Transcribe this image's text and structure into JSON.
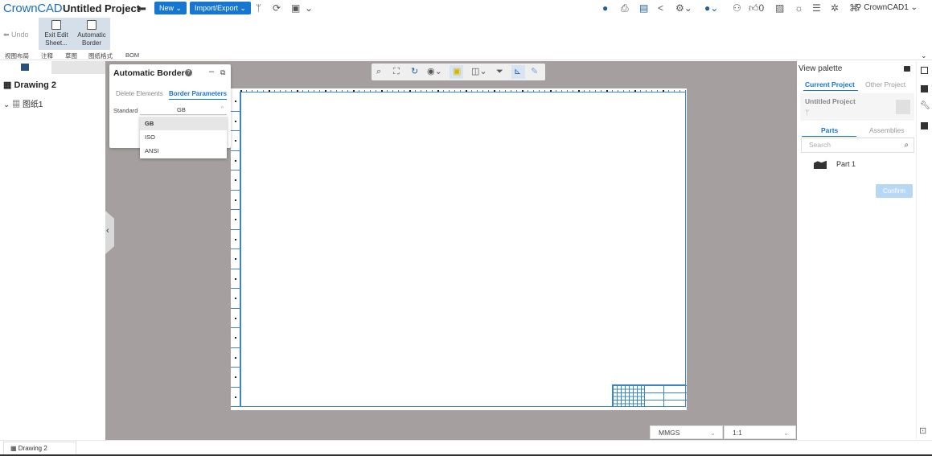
{
  "app": {
    "logo": "CrownCAD",
    "project_title": "Untitled Project",
    "new_label": "New",
    "import_export_label": "Import/Export",
    "notification_count": "0",
    "user_name": "CrownCAD1"
  },
  "ribbon": {
    "undo_label": "Undo",
    "exit_edit_sheet_label": "Exit Edit Sheet...",
    "automatic_border_label": "Automatic Border"
  },
  "tabs": [
    "视图布局",
    "注释",
    "草图",
    "图纸格式",
    "BOM"
  ],
  "tree": {
    "root_label": "Drawing 2",
    "child_label": "图纸1"
  },
  "popup": {
    "title": "Automatic Border",
    "tab_delete": "Delete Elements",
    "tab_border": "Border Parameters",
    "standard_label": "Standard",
    "standard_value": "GB",
    "options": [
      "GB",
      "ISO",
      "ANSI"
    ]
  },
  "bottom": {
    "unit_system": "MMGS",
    "scale": "1:1"
  },
  "view_palette": {
    "title": "View palette",
    "tab_current": "Current Project",
    "tab_other": "Other Project",
    "project_name": "Untitled Project",
    "subtab_parts": "Parts",
    "subtab_assemblies": "Assemblies",
    "search_placeholder": "Search",
    "part_name": "Part 1",
    "confirm_label": "Confirm"
  },
  "status": {
    "sheet_tab": "Drawing 2"
  },
  "colors": {
    "accent": "#1677d2",
    "canvas_bg": "#a5a09f",
    "frame": "#3a86c8"
  }
}
